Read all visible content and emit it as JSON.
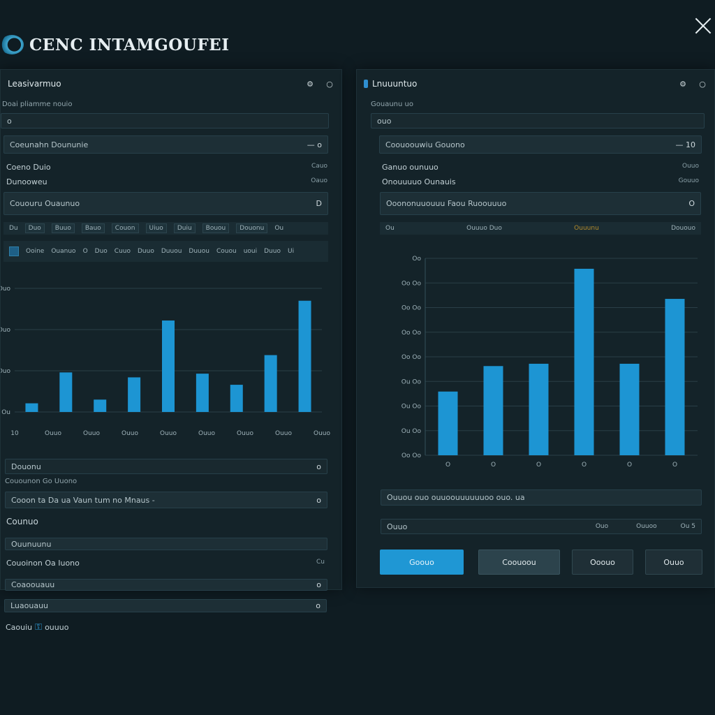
{
  "app": {
    "title": "CENC INTAMGOUFEI"
  },
  "left_panel": {
    "header": "Leasivarmuo",
    "section_label": "Doai pliamme nouio",
    "search_placeholder": "o",
    "select1": {
      "label": "Coeunahn Doununie",
      "value": "— o"
    },
    "row1": {
      "label": "Coeno Duio",
      "value": "Cauo"
    },
    "row2": {
      "label": "Dunooweu",
      "value": "Oauo"
    },
    "select2": {
      "label": "Cououru Ouaunuo",
      "value": "D"
    },
    "tabs": [
      "Du",
      "Duo",
      "Buuo",
      "Bauo",
      "Couon",
      "Uiuo",
      "Duiu",
      "Bouou",
      "Douonu",
      "Ou"
    ],
    "toolbar": [
      "Ooine",
      "Ouanuo",
      "O",
      "Duo",
      "Cuuo",
      "Duuo",
      "Duuou",
      "Duuou",
      "Couou",
      "uoui",
      "Duuo",
      "Ui"
    ],
    "footer": {
      "select1": {
        "label": "Douonu",
        "value": "o"
      },
      "caption": "Couounon Go Uuono",
      "input1": {
        "label": "Cooon ta Da ua Vaun tum no Mnaus -",
        "value": "o"
      },
      "heading": "Counuo",
      "select2": {
        "label": "Ouunuunu",
        "value": ""
      },
      "row3": {
        "label": "Couoinon Oa Iuono",
        "value": "Cu"
      },
      "select3": {
        "label": "Coaoouauu",
        "value": "o"
      },
      "select4": {
        "label": "Luaouauu",
        "value": "o"
      },
      "link_row": {
        "prefix": "Caouiu",
        "suffix": "ouuuo"
      }
    }
  },
  "right_panel": {
    "header": "Lnuuuntuo",
    "section_label": "Gouaunu uo",
    "search_placeholder": "ouo",
    "select1": {
      "label": "Coouoouwiu Gouono",
      "value": "— 10"
    },
    "row1": {
      "label": "Ganuo ounuuo",
      "value": "Ouuo"
    },
    "row2": {
      "label": "Onouuuuo Ounauis",
      "value": "Gouuo"
    },
    "select2": {
      "label": "Ooononuuouuu Faou Ruoouuuo",
      "value": "O"
    },
    "tabs": [
      {
        "label": "Ou",
        "highlight": false
      },
      {
        "label": "Ouuuo Duo",
        "highlight": false
      },
      {
        "label": "Ouuunu",
        "highlight": true
      },
      {
        "label": "Dououo",
        "highlight": false
      }
    ],
    "footer": {
      "input1": {
        "label": "Ouuou ouo ouuoouuuuuuoo ouo. ua"
      },
      "row": {
        "label": "Ouuo",
        "v1": "Ouo",
        "v2": "Ouuoo",
        "v3": "Ou 5"
      },
      "buttons": {
        "primary": "Goouo",
        "secondary": "Coouoou",
        "tertiary": "Ooouo",
        "quaternary": "Ouuo"
      }
    }
  },
  "chart_data": [
    {
      "type": "bar",
      "categories": [
        "10",
        "Ouuo",
        "Ouuo",
        "Ouuo",
        "Ouuo",
        "Ouuo",
        "Ouuo",
        "Ouuo",
        "Ouuo"
      ],
      "y_tick_labels": [
        "Ou",
        "Ouo",
        "Ouo",
        "Ouo"
      ],
      "values": [
        0.35,
        1.6,
        0.5,
        1.4,
        3.7,
        1.55,
        1.1,
        2.3,
        4.5
      ],
      "ylim": [
        0,
        5
      ],
      "grid": true,
      "colors": [
        "#1d95d3"
      ],
      "title": "",
      "xlabel": "",
      "ylabel": ""
    },
    {
      "type": "bar",
      "categories": [
        "O",
        "O",
        "O",
        "O",
        "O",
        "O"
      ],
      "y_tick_labels": [
        "Oo Oo",
        "Ou Oo",
        "Ou Oo",
        "Ou Oo",
        "Oo Oo",
        "Oo Oo",
        "Oo Oo",
        "Oo Oo",
        "Oo"
      ],
      "values": [
        2.75,
        3.85,
        3.95,
        8.05,
        3.95,
        6.75
      ],
      "ylim": [
        0,
        8.5
      ],
      "grid": true,
      "colors": [
        "#1d95d3"
      ],
      "title": "",
      "xlabel": "",
      "ylabel": ""
    }
  ]
}
